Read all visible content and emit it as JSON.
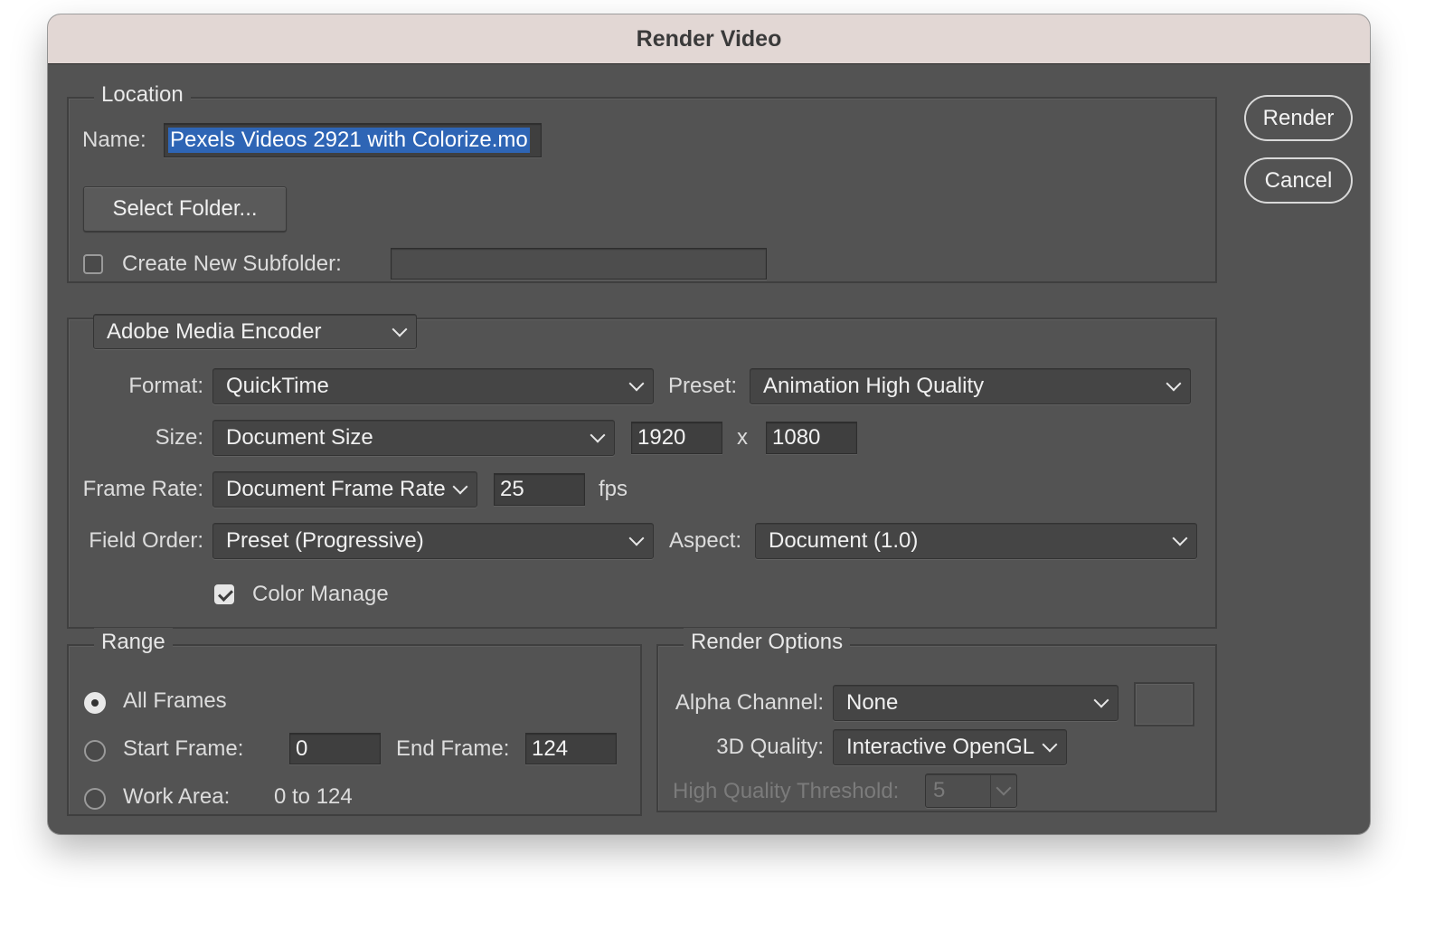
{
  "window": {
    "title": "Render Video"
  },
  "buttons": {
    "render": "Render",
    "cancel": "Cancel"
  },
  "location": {
    "legend": "Location",
    "name_label": "Name:",
    "name_value": "Pexels Videos 2921 with Colorize.mo",
    "select_folder": "Select Folder...",
    "create_subfolder_label": "Create New Subfolder:",
    "create_subfolder_checked": false,
    "subfolder_value": ""
  },
  "encoder": {
    "selected": "Adobe Media Encoder",
    "format_label": "Format:",
    "format_value": "QuickTime",
    "preset_label": "Preset:",
    "preset_value": "Animation High Quality",
    "size_label": "Size:",
    "size_value": "Document Size",
    "width": "1920",
    "x_sep": "x",
    "height": "1080",
    "frame_rate_label": "Frame Rate:",
    "frame_rate_value": "Document Frame Rate",
    "fps_value": "25",
    "fps_unit": "fps",
    "field_order_label": "Field Order:",
    "field_order_value": "Preset (Progressive)",
    "aspect_label": "Aspect:",
    "aspect_value": "Document (1.0)",
    "color_manage_label": "Color Manage",
    "color_manage_checked": true
  },
  "range": {
    "legend": "Range",
    "all_frames": "All Frames",
    "start_frame_label": "Start Frame:",
    "start_frame_value": "0",
    "end_frame_label": "End Frame:",
    "end_frame_value": "124",
    "work_area_label": "Work Area:",
    "work_area_value": "0 to 124",
    "selected": "All Frames"
  },
  "render_options": {
    "legend": "Render Options",
    "alpha_label": "Alpha Channel:",
    "alpha_value": "None",
    "quality_label": "3D Quality:",
    "quality_value": "Interactive OpenGL",
    "threshold_label": "High Quality Threshold:",
    "threshold_value": "5"
  },
  "colors": {
    "window_bg": "#535353",
    "titlebar_bg": "#e2d7d4",
    "selection": "#2e65b5"
  }
}
